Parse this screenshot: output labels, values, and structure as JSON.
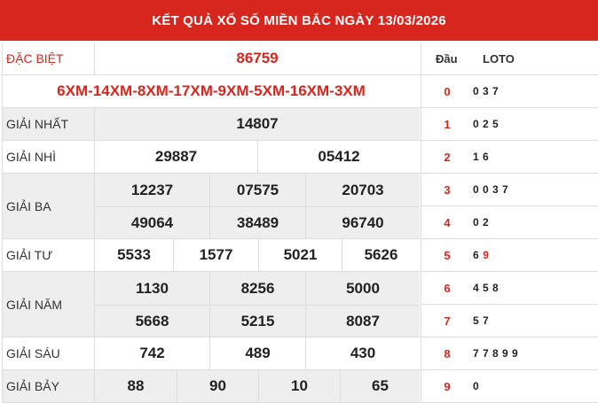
{
  "header": {
    "title": "KẾT QUẢ XỔ SỐ MIỀN BẮC NGÀY 13/03/2026"
  },
  "colors": {
    "brand_red": "#d7261e",
    "row_gray": "#eeeeee"
  },
  "results": {
    "special": {
      "label": "ĐẶC BIỆT",
      "value": "86759"
    },
    "codes": "6XM-14XM-8XM-17XM-9XM-5XM-16XM-3XM",
    "first": {
      "label": "GIẢI NHẤT",
      "values": [
        "14807"
      ]
    },
    "second": {
      "label": "GIẢI NHÌ",
      "values": [
        "29887",
        "05412"
      ]
    },
    "third": {
      "label": "GIẢI BA",
      "values": [
        "12237",
        "07575",
        "20703",
        "49064",
        "38489",
        "96740"
      ]
    },
    "fourth": {
      "label": "GIẢI TƯ",
      "values": [
        "5533",
        "1577",
        "5021",
        "5626"
      ]
    },
    "fifth": {
      "label": "GIẢI NĂM",
      "values": [
        "1130",
        "8256",
        "5000",
        "5668",
        "5215",
        "8087"
      ]
    },
    "sixth": {
      "label": "GIẢI SÁU",
      "values": [
        "742",
        "489",
        "430"
      ]
    },
    "seventh": {
      "label": "GIẢI BẢY",
      "values": [
        "88",
        "90",
        "10",
        "65"
      ]
    }
  },
  "loto": {
    "head_label": "Đầu",
    "tail_label": "LOTO",
    "rows": [
      {
        "head": "0",
        "tails": "0 3 7",
        "highlight": ""
      },
      {
        "head": "1",
        "tails": "0 2 5",
        "highlight": ""
      },
      {
        "head": "2",
        "tails": "1 6",
        "highlight": ""
      },
      {
        "head": "3",
        "tails": "0 0 3 7",
        "highlight": ""
      },
      {
        "head": "4",
        "tails": "0 2",
        "highlight": ""
      },
      {
        "head": "5",
        "tails": "6",
        "highlight": "9"
      },
      {
        "head": "6",
        "tails": "4 5 8",
        "highlight": ""
      },
      {
        "head": "7",
        "tails": "5 7",
        "highlight": ""
      },
      {
        "head": "8",
        "tails": "7 7 8 9 9",
        "highlight": ""
      },
      {
        "head": "9",
        "tails": "0",
        "highlight": ""
      }
    ]
  }
}
